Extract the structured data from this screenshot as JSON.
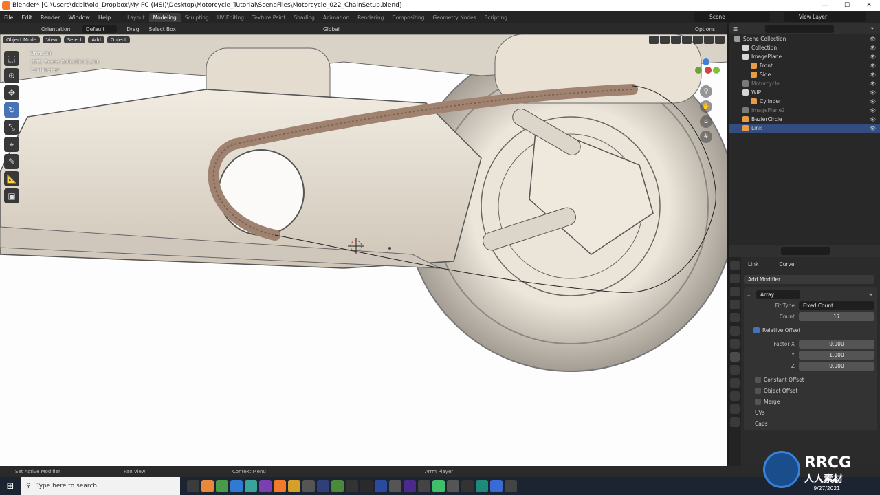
{
  "window": {
    "title": "Blender* [C:\\Users\\dcbit\\old_Dropbox\\My PC (MSI)\\Desktop\\Motorcycle_Tutorial\\SceneFiles\\Motorcycle_022_ChainSetup.blend]",
    "controls": [
      "—",
      "☐",
      "✕"
    ]
  },
  "menu": [
    "File",
    "Edit",
    "Render",
    "Window",
    "Help"
  ],
  "workspaces": [
    {
      "label": "Layout",
      "active": false
    },
    {
      "label": "Modeling",
      "active": true
    },
    {
      "label": "Sculpting",
      "active": false
    },
    {
      "label": "UV Editing",
      "active": false
    },
    {
      "label": "Texture Paint",
      "active": false
    },
    {
      "label": "Shading",
      "active": false
    },
    {
      "label": "Animation",
      "active": false
    },
    {
      "label": "Rendering",
      "active": false
    },
    {
      "label": "Compositing",
      "active": false
    },
    {
      "label": "Geometry Nodes",
      "active": false
    },
    {
      "label": "Scripting",
      "active": false
    }
  ],
  "scene": "Scene",
  "view_layer": "View Layer",
  "tool_header": {
    "orientation_label": "Orientation:",
    "orientation": "Default",
    "drag_label": "Drag",
    "drag": "Select Box",
    "transform": "Global",
    "options": "Options"
  },
  "viewport": {
    "mode": "Object Mode",
    "menus": [
      "View",
      "Select",
      "Add",
      "Object"
    ],
    "info_line1": "Ortho 24",
    "info_line2": "(151) Scene Collection | Link",
    "info_line3": "Centimeters"
  },
  "outliner": {
    "rows": [
      {
        "label": "Scene Collection",
        "indent": 0,
        "color": "#9a9a9a",
        "selected": false,
        "dim": false
      },
      {
        "label": "Collection",
        "indent": 1,
        "color": "#d6d6d6",
        "selected": false,
        "dim": false
      },
      {
        "label": "ImagePlane",
        "indent": 1,
        "color": "#d6d6d6",
        "selected": false,
        "dim": false
      },
      {
        "label": "Front",
        "indent": 2,
        "color": "#e89a45",
        "selected": false,
        "dim": false
      },
      {
        "label": "Side",
        "indent": 2,
        "color": "#e89a45",
        "selected": false,
        "dim": false
      },
      {
        "label": "Motorcycle",
        "indent": 1,
        "color": "#7a7a7a",
        "selected": false,
        "dim": true
      },
      {
        "label": "WIP",
        "indent": 1,
        "color": "#d6d6d6",
        "selected": false,
        "dim": false
      },
      {
        "label": "Cylinder",
        "indent": 2,
        "color": "#e89a45",
        "selected": false,
        "dim": false
      },
      {
        "label": "ImagePlane2",
        "indent": 1,
        "color": "#7a7a7a",
        "selected": false,
        "dim": true
      },
      {
        "label": "BezierCircle",
        "indent": 1,
        "color": "#e89a45",
        "selected": false,
        "dim": false
      },
      {
        "label": "Link",
        "indent": 1,
        "color": "#e89a45",
        "selected": true,
        "dim": false
      }
    ]
  },
  "properties": {
    "object_name": "Link",
    "data_name": "Curve",
    "add_modifier": "Add Modifier",
    "modifier_name": "Array",
    "fit_type_label": "Fit Type",
    "fit_type": "Fixed Count",
    "count_label": "Count",
    "count": "17",
    "relative_offset": "Relative Offset",
    "factor_x_label": "Factor X",
    "factor_x": "0.000",
    "y_label": "Y",
    "factor_y": "1.000",
    "z_label": "Z",
    "factor_z": "0.000",
    "subpanels": [
      "Constant Offset",
      "Object Offset",
      "Merge",
      "UVs",
      "Caps"
    ]
  },
  "status_bar": {
    "left": "Set Active Modifier",
    "mid1": "Pan View",
    "mid2": "Context Menu",
    "right": "Arrm Player"
  },
  "taskbar": {
    "search_placeholder": "Type here to search",
    "time": "1:15 PM",
    "date": "9/27/2021"
  },
  "watermark": {
    "line1": "RRCG",
    "line2": "人人素材"
  },
  "colors": {
    "accent": "#4772b3",
    "selected_row": "#334d80",
    "chain": "#a08270",
    "model": "#e9e2d6"
  }
}
